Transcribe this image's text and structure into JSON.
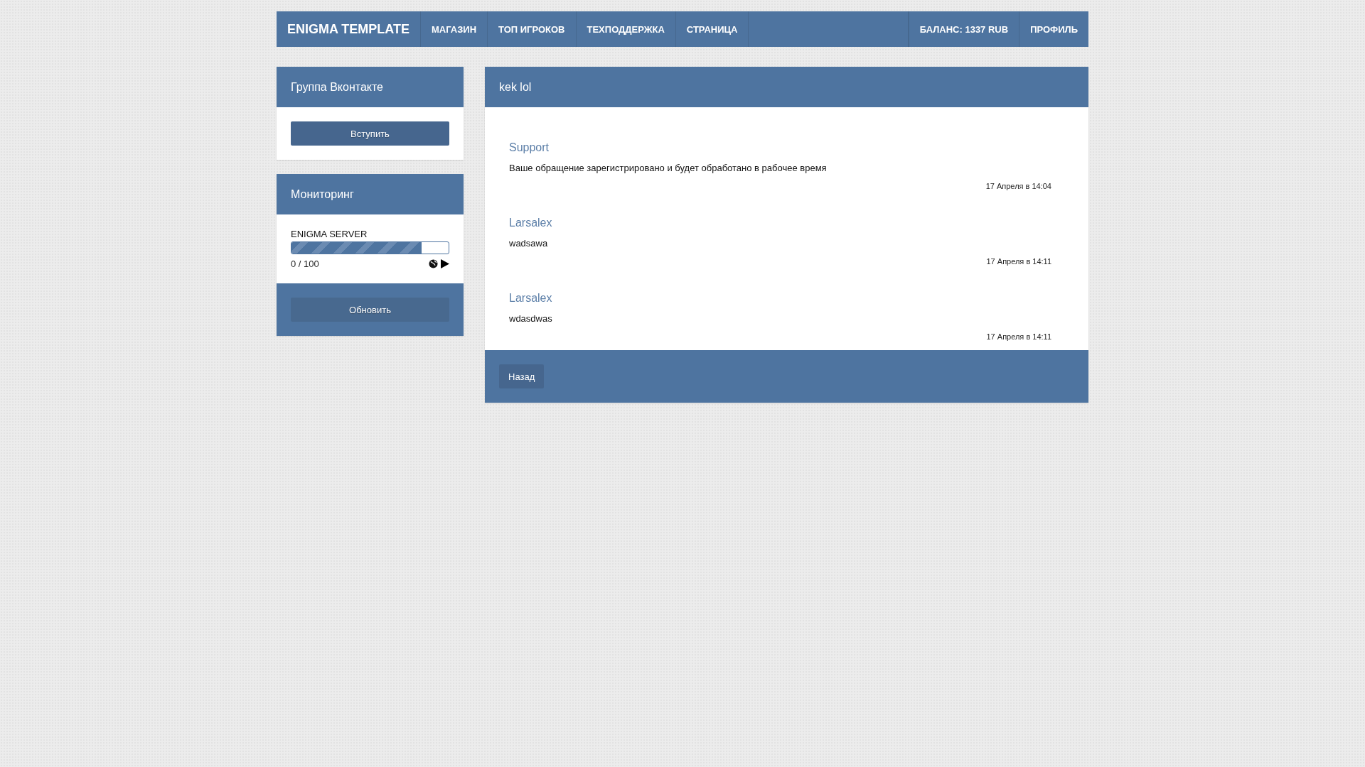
{
  "nav": {
    "brand": "ENIGMA TEMPLATE",
    "links": [
      "МАГАЗИН",
      "ТОП ИГРОКОВ",
      "ТЕХПОДДЕРЖКА",
      "СТРАНИЦА"
    ],
    "right": [
      "БАЛАНС: 1337 RUB",
      "ПРОФИЛЬ"
    ]
  },
  "sidebar": [
    {
      "kind": "group",
      "title": "Группа Вконтакте",
      "button": "Вступить"
    },
    {
      "kind": "monitoring",
      "title": "Мониторинг",
      "server": "ENIGMA SERVER",
      "level": 0.83,
      "players": "0 / 100",
      "button": "Обновить"
    }
  ],
  "ticket": {
    "title": "kek lol",
    "messages": [
      {
        "author": "Support",
        "text": "Ваше обращение зарегистрировано и будет обработано в рабочее время",
        "date": "17 Апреля в 14:04"
      },
      {
        "author": "Larsalex",
        "text": "wadsawa",
        "date": "17 Апреля в 14:11"
      },
      {
        "author": "Larsalex",
        "text": "wdasdwas",
        "date": "17 Апреля в 14:11"
      }
    ],
    "back_button": "Назад"
  }
}
